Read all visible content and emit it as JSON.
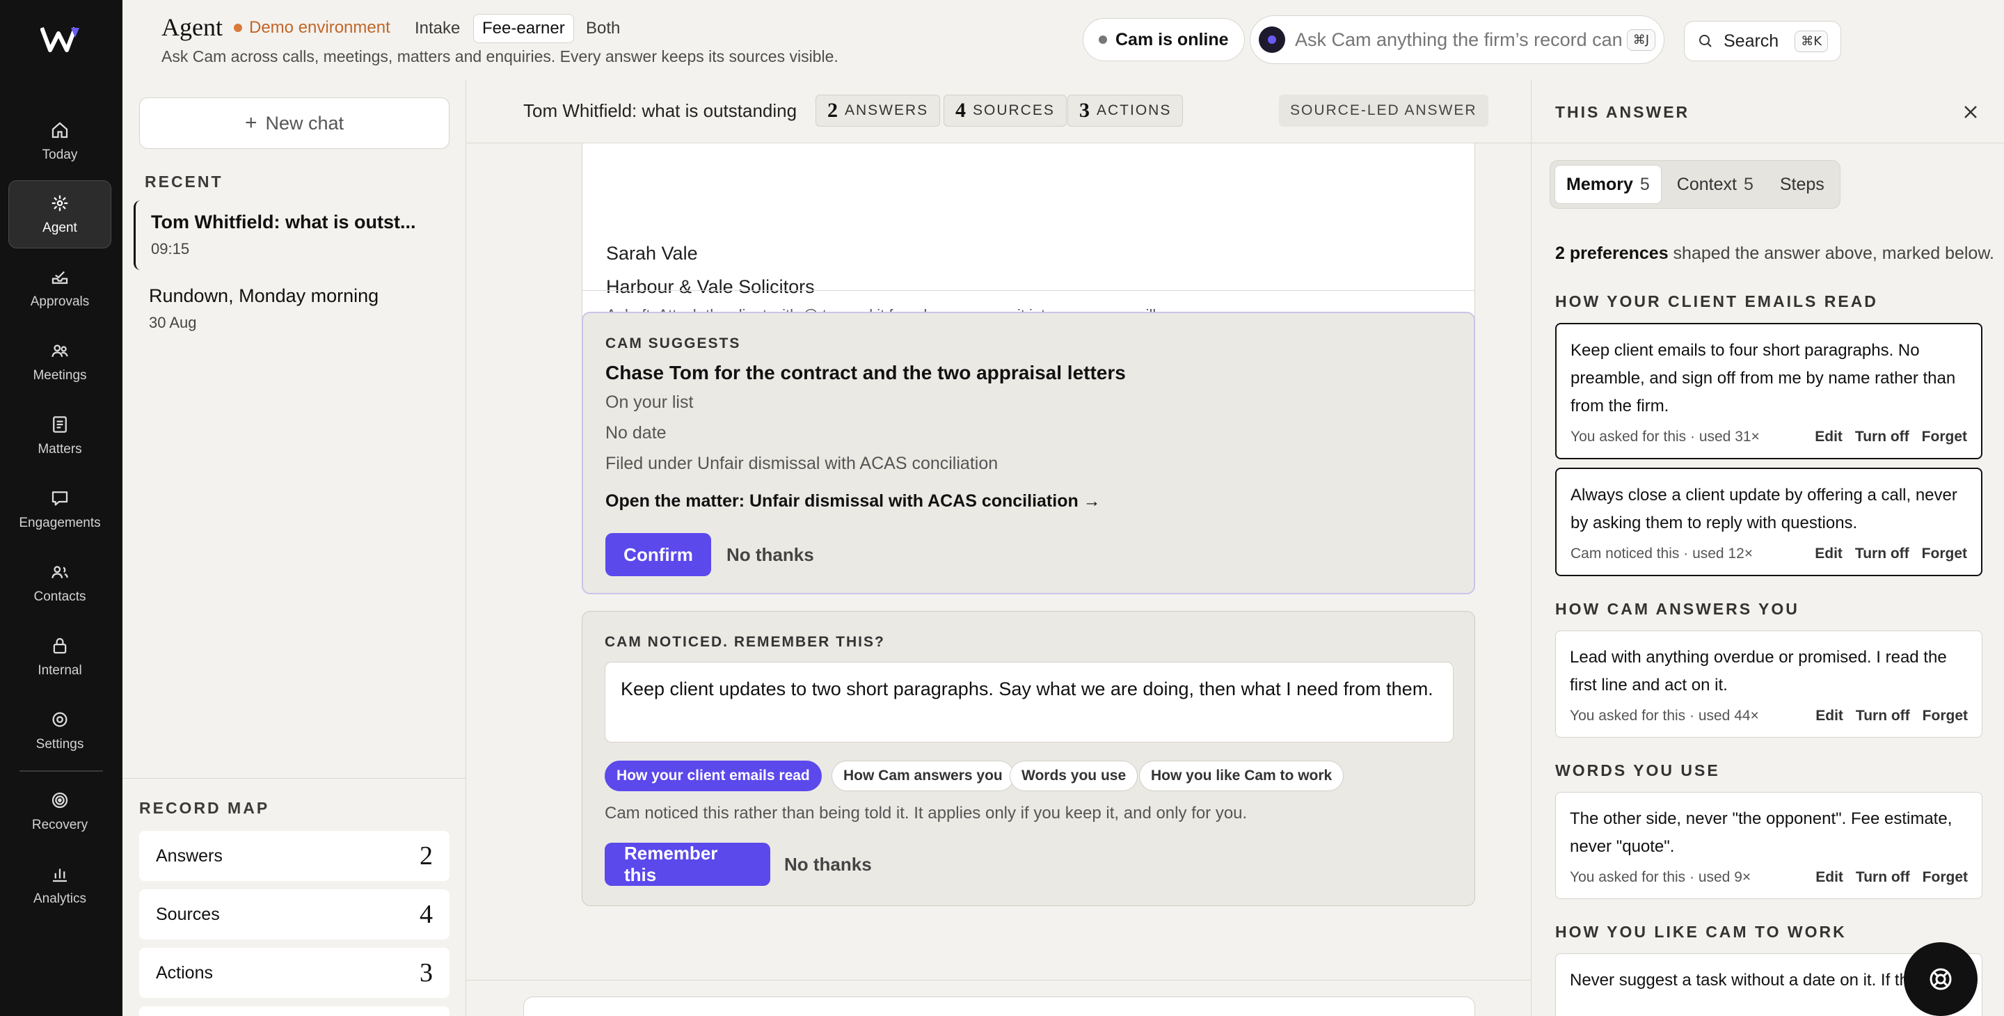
{
  "rail": {
    "items": [
      {
        "label": "Today",
        "icon": "home-icon"
      },
      {
        "label": "Agent",
        "icon": "sparkle-icon"
      },
      {
        "label": "Approvals",
        "icon": "inbox-icon"
      },
      {
        "label": "Meetings",
        "icon": "people-icon"
      },
      {
        "label": "Matters",
        "icon": "document-icon"
      },
      {
        "label": "Engagements",
        "icon": "chat-bubble-icon"
      },
      {
        "label": "Contacts",
        "icon": "contacts-icon"
      },
      {
        "label": "Internal",
        "icon": "lock-icon"
      },
      {
        "label": "Settings",
        "icon": "gear-icon"
      },
      {
        "label": "Recovery",
        "icon": "target-icon"
      },
      {
        "label": "Analytics",
        "icon": "bar-chart-icon"
      }
    ],
    "active": "Agent"
  },
  "header": {
    "title": "Agent",
    "environment": "Demo environment",
    "modes": [
      "Intake",
      "Fee-earner",
      "Both"
    ],
    "selected_mode": "Fee-earner",
    "subtitle": "Ask Cam across calls, meetings, matters and enquiries. Every answer keeps its sources visible.",
    "status": "Cam is online",
    "ask_placeholder": "Ask Cam anything the firm’s record can answer",
    "ask_shortcut": "⌘J",
    "search_label": "Search",
    "search_shortcut": "⌘K"
  },
  "chats": {
    "new_chat": "New chat",
    "recent_label": "RECENT",
    "items": [
      {
        "title": "Tom Whitfield: what is outst...",
        "time": "09:15"
      },
      {
        "title": "Rundown, Monday morning",
        "time": "30 Aug"
      }
    ]
  },
  "record_map": {
    "label": "RECORD MAP",
    "rows": [
      {
        "label": "Answers",
        "count": "2"
      },
      {
        "label": "Sources",
        "count": "4"
      },
      {
        "label": "Actions",
        "count": "3"
      }
    ]
  },
  "conversation": {
    "title": "Tom Whitfield: what is outstanding",
    "counts": [
      {
        "n": "2",
        "label": "ANSWERS"
      },
      {
        "n": "4",
        "label": "SOURCES"
      },
      {
        "n": "3",
        "label": "ACTIONS"
      }
    ],
    "badge": "SOURCE-LED ANSWER",
    "draft": {
      "signature_name": "Sarah Vale",
      "signature_firm": "Harbour & Vale Solicitors",
      "footer": "A draft. Attach the client with @ to send it from here, or copy it into your own mailbox."
    },
    "suggestion": {
      "eyebrow": "CAM SUGGESTS",
      "title": "Chase Tom for the contract and the two appraisal letters",
      "lines": [
        "On your list",
        "No date",
        "Filed under Unfair dismissal with ACAS conciliation"
      ],
      "link": "Open the matter: Unfair dismissal with ACAS conciliation →",
      "confirm": "Confirm",
      "decline": "No thanks"
    },
    "notice": {
      "eyebrow": "CAM NOTICED. REMEMBER THIS?",
      "text": "Keep client updates to two short paragraphs. Say what we are doing, then what I need from them.",
      "chips": [
        "How your client emails read",
        "How Cam answers you",
        "Words you use",
        "How you like Cam to work"
      ],
      "selected_chip": "How your client emails read",
      "note": "Cam noticed this rather than being told it. It applies only if you keep it, and only for you.",
      "remember": "Remember this",
      "decline": "No thanks"
    }
  },
  "panel": {
    "title": "THIS ANSWER",
    "tabs": [
      {
        "label": "Memory",
        "count": "5"
      },
      {
        "label": "Context",
        "count": "5"
      },
      {
        "label": "Steps",
        "count": ""
      }
    ],
    "selected_tab": "Memory",
    "summary_bold": "2 preferences",
    "summary_rest": " shaped the answer above, marked below.",
    "actions": [
      "Edit",
      "Turn off",
      "Forget"
    ],
    "groups": [
      {
        "label": "HOW YOUR CLIENT EMAILS READ",
        "prefs": [
          {
            "text": "Keep client emails to four short paragraphs. No preamble, and sign off from me by name rather than from the firm.",
            "meta": "You asked for this · used 31×",
            "marked": true
          },
          {
            "text": "Always close a client update by offering a call, never by asking them to reply with questions.",
            "meta": "Cam noticed this · used 12×",
            "marked": true
          }
        ]
      },
      {
        "label": "HOW CAM ANSWERS YOU",
        "prefs": [
          {
            "text": "Lead with anything overdue or promised. I read the first line and act on it.",
            "meta": "You asked for this · used 44×",
            "marked": false
          }
        ]
      },
      {
        "label": "WORDS YOU USE",
        "prefs": [
          {
            "text": "The other side, never \"the opponent\". Fee estimate, never \"quote\".",
            "meta": "You asked for this · used 9×",
            "marked": false
          }
        ]
      },
      {
        "label": "HOW YOU LIKE CAM TO WORK",
        "prefs": [
          {
            "text": "Never suggest a task without a date on it. If there",
            "meta": "",
            "marked": false
          }
        ]
      }
    ]
  },
  "colors": {
    "accent": "#5b49ec",
    "demo": "#c0662a",
    "rail": "#121212"
  }
}
